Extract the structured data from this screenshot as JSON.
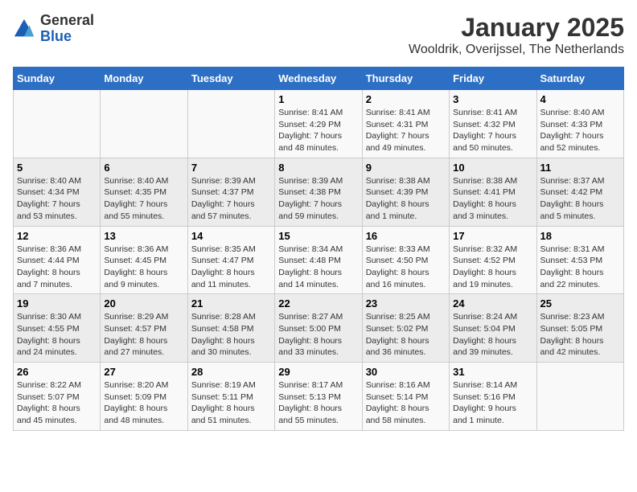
{
  "logo": {
    "general": "General",
    "blue": "Blue"
  },
  "title": "January 2025",
  "subtitle": "Wooldrik, Overijssel, The Netherlands",
  "days_of_week": [
    "Sunday",
    "Monday",
    "Tuesday",
    "Wednesday",
    "Thursday",
    "Friday",
    "Saturday"
  ],
  "weeks": [
    [
      {
        "num": "",
        "info": ""
      },
      {
        "num": "",
        "info": ""
      },
      {
        "num": "",
        "info": ""
      },
      {
        "num": "1",
        "info": "Sunrise: 8:41 AM\nSunset: 4:29 PM\nDaylight: 7 hours\nand 48 minutes."
      },
      {
        "num": "2",
        "info": "Sunrise: 8:41 AM\nSunset: 4:31 PM\nDaylight: 7 hours\nand 49 minutes."
      },
      {
        "num": "3",
        "info": "Sunrise: 8:41 AM\nSunset: 4:32 PM\nDaylight: 7 hours\nand 50 minutes."
      },
      {
        "num": "4",
        "info": "Sunrise: 8:40 AM\nSunset: 4:33 PM\nDaylight: 7 hours\nand 52 minutes."
      }
    ],
    [
      {
        "num": "5",
        "info": "Sunrise: 8:40 AM\nSunset: 4:34 PM\nDaylight: 7 hours\nand 53 minutes."
      },
      {
        "num": "6",
        "info": "Sunrise: 8:40 AM\nSunset: 4:35 PM\nDaylight: 7 hours\nand 55 minutes."
      },
      {
        "num": "7",
        "info": "Sunrise: 8:39 AM\nSunset: 4:37 PM\nDaylight: 7 hours\nand 57 minutes."
      },
      {
        "num": "8",
        "info": "Sunrise: 8:39 AM\nSunset: 4:38 PM\nDaylight: 7 hours\nand 59 minutes."
      },
      {
        "num": "9",
        "info": "Sunrise: 8:38 AM\nSunset: 4:39 PM\nDaylight: 8 hours\nand 1 minute."
      },
      {
        "num": "10",
        "info": "Sunrise: 8:38 AM\nSunset: 4:41 PM\nDaylight: 8 hours\nand 3 minutes."
      },
      {
        "num": "11",
        "info": "Sunrise: 8:37 AM\nSunset: 4:42 PM\nDaylight: 8 hours\nand 5 minutes."
      }
    ],
    [
      {
        "num": "12",
        "info": "Sunrise: 8:36 AM\nSunset: 4:44 PM\nDaylight: 8 hours\nand 7 minutes."
      },
      {
        "num": "13",
        "info": "Sunrise: 8:36 AM\nSunset: 4:45 PM\nDaylight: 8 hours\nand 9 minutes."
      },
      {
        "num": "14",
        "info": "Sunrise: 8:35 AM\nSunset: 4:47 PM\nDaylight: 8 hours\nand 11 minutes."
      },
      {
        "num": "15",
        "info": "Sunrise: 8:34 AM\nSunset: 4:48 PM\nDaylight: 8 hours\nand 14 minutes."
      },
      {
        "num": "16",
        "info": "Sunrise: 8:33 AM\nSunset: 4:50 PM\nDaylight: 8 hours\nand 16 minutes."
      },
      {
        "num": "17",
        "info": "Sunrise: 8:32 AM\nSunset: 4:52 PM\nDaylight: 8 hours\nand 19 minutes."
      },
      {
        "num": "18",
        "info": "Sunrise: 8:31 AM\nSunset: 4:53 PM\nDaylight: 8 hours\nand 22 minutes."
      }
    ],
    [
      {
        "num": "19",
        "info": "Sunrise: 8:30 AM\nSunset: 4:55 PM\nDaylight: 8 hours\nand 24 minutes."
      },
      {
        "num": "20",
        "info": "Sunrise: 8:29 AM\nSunset: 4:57 PM\nDaylight: 8 hours\nand 27 minutes."
      },
      {
        "num": "21",
        "info": "Sunrise: 8:28 AM\nSunset: 4:58 PM\nDaylight: 8 hours\nand 30 minutes."
      },
      {
        "num": "22",
        "info": "Sunrise: 8:27 AM\nSunset: 5:00 PM\nDaylight: 8 hours\nand 33 minutes."
      },
      {
        "num": "23",
        "info": "Sunrise: 8:25 AM\nSunset: 5:02 PM\nDaylight: 8 hours\nand 36 minutes."
      },
      {
        "num": "24",
        "info": "Sunrise: 8:24 AM\nSunset: 5:04 PM\nDaylight: 8 hours\nand 39 minutes."
      },
      {
        "num": "25",
        "info": "Sunrise: 8:23 AM\nSunset: 5:05 PM\nDaylight: 8 hours\nand 42 minutes."
      }
    ],
    [
      {
        "num": "26",
        "info": "Sunrise: 8:22 AM\nSunset: 5:07 PM\nDaylight: 8 hours\nand 45 minutes."
      },
      {
        "num": "27",
        "info": "Sunrise: 8:20 AM\nSunset: 5:09 PM\nDaylight: 8 hours\nand 48 minutes."
      },
      {
        "num": "28",
        "info": "Sunrise: 8:19 AM\nSunset: 5:11 PM\nDaylight: 8 hours\nand 51 minutes."
      },
      {
        "num": "29",
        "info": "Sunrise: 8:17 AM\nSunset: 5:13 PM\nDaylight: 8 hours\nand 55 minutes."
      },
      {
        "num": "30",
        "info": "Sunrise: 8:16 AM\nSunset: 5:14 PM\nDaylight: 8 hours\nand 58 minutes."
      },
      {
        "num": "31",
        "info": "Sunrise: 8:14 AM\nSunset: 5:16 PM\nDaylight: 9 hours\nand 1 minute."
      },
      {
        "num": "",
        "info": ""
      }
    ]
  ]
}
